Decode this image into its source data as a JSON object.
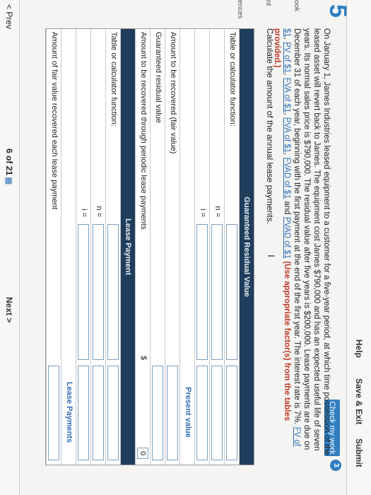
{
  "header": {
    "help": "Help",
    "save_exit": "Save & Exit",
    "submit": "Submit",
    "check_work": "Check my work",
    "badge": "3"
  },
  "question_number": "5",
  "side_labels": [
    "ook",
    "nt",
    "ences"
  ],
  "problem": {
    "text": "On January 1, James Industries leased equipment to a customer for a five-year period, at which time possession of the leased asset will revert back to James. The equipment cost James $790,000 and has an expected useful life of seven years. Its normal sales price is $790,000. The residual value after five years is $200,000. Lease payments are due on December 31 of each year, beginning with the first payment at the end of the first year. The interest rate is 7%.",
    "links": [
      "FV of $1",
      "PV of $1",
      "FVA of $1",
      "PVA of $1",
      "FVAD of $1",
      "PVAD of $1"
    ],
    "link_and": "and",
    "instruction": "(Use appropriate factor(s) from the tables provided.)"
  },
  "calc_line": "Calculate the amount of the annual lease payments.",
  "table": {
    "grv_header": "Guaranteed Residual Value",
    "table_fn_label": "Table or calculator function:",
    "n_label": "n =",
    "i_label": "i =",
    "present_value_header": "Present value",
    "amount_recovered_fv": "Amount to be recovered (fair value)",
    "guaranteed_residual": "Guaranteed residual value",
    "amount_periodic": "Amount to be recovered through periodic lease payments",
    "dollar": "$",
    "periodic_value": "0",
    "lease_payment_header": "Lease Payment",
    "lease_payments_header": "Lease Payments",
    "fair_value_recovered": "Amount of fair value recovered each lease payment"
  },
  "footer": {
    "prev": "< Prev",
    "page": "6 of 21",
    "next": "Next >"
  }
}
